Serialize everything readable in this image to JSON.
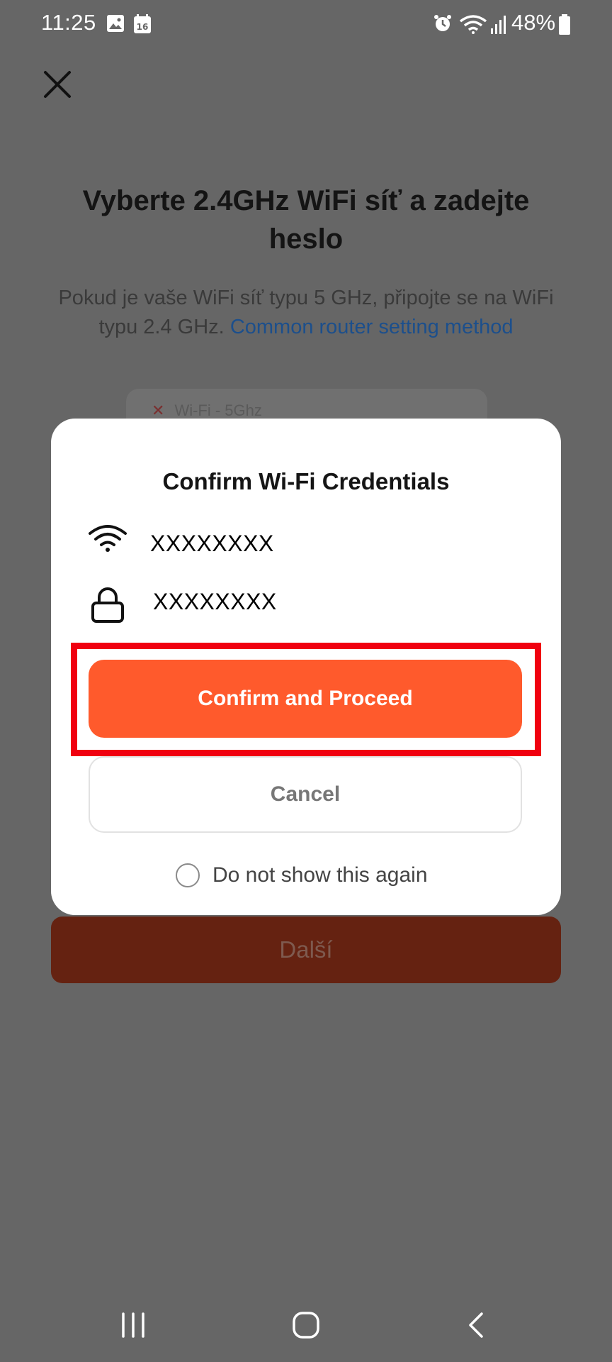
{
  "status_bar": {
    "time": "11:25",
    "calendar_day": "16",
    "battery": "48%",
    "icons": [
      "image-icon",
      "calendar-icon",
      "alarm-icon",
      "wifi-icon",
      "signal-icon",
      "battery-icon"
    ]
  },
  "page": {
    "close_icon": "close-icon",
    "title": "Vyberte 2.4GHz WiFi síť a zadejte heslo",
    "subtitle": "Pokud je vaše WiFi síť typu 5 GHz, připojte se na WiFi typu 2.4 GHz.",
    "subtitle_link": "Common router setting method",
    "wifi_5ghz_label": "Wi-Fi - 5Ghz",
    "next_button": "Další"
  },
  "dialog": {
    "title": "Confirm Wi-Fi Credentials",
    "ssid": "XXXXXXXX",
    "password": "XXXXXXXX",
    "confirm_button": "Confirm and Proceed",
    "cancel_button": "Cancel",
    "dont_show_again": "Do not show this again",
    "dont_show_checked": false
  },
  "colors": {
    "accent": "#ff5a2c",
    "highlight": "#f00010",
    "overlay": "#666666",
    "link": "#1c4f8c"
  },
  "nav_bar": {
    "icons": [
      "recent-apps-icon",
      "home-icon",
      "back-icon"
    ]
  }
}
